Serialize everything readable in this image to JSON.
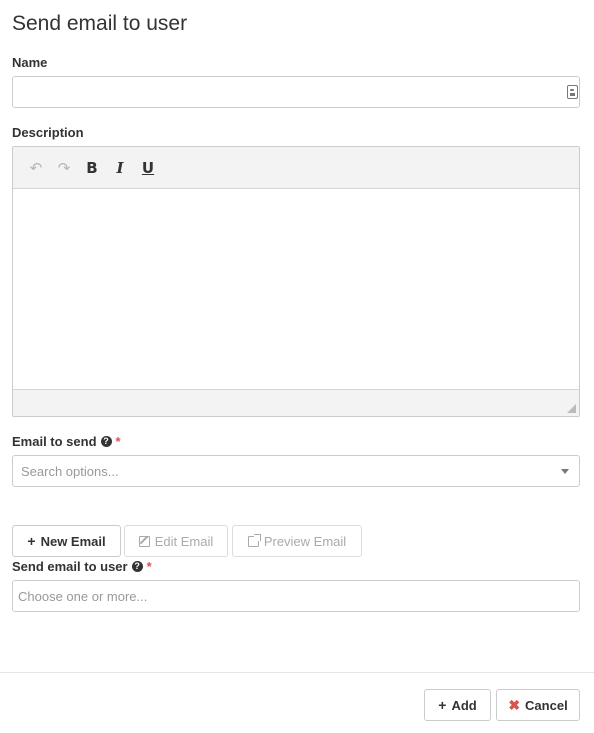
{
  "dialog": {
    "title": "Send email to user"
  },
  "name_field": {
    "label": "Name",
    "value": "",
    "placeholder": "",
    "icon": "contact-card-icon"
  },
  "description_field": {
    "label": "Description",
    "toolbar": {
      "undo": "↶",
      "redo": "↷",
      "bold": "B",
      "italic": "I",
      "underline": "U"
    }
  },
  "email_to_send": {
    "label": "Email to send",
    "help": "?",
    "required": "*",
    "placeholder": "Search options..."
  },
  "email_actions": {
    "new_email": "New Email",
    "edit_email": "Edit Email",
    "preview_email": "Preview Email"
  },
  "send_to_user": {
    "label": "Send email to user",
    "help": "?",
    "required": "*",
    "placeholder": "Choose one or more..."
  },
  "footer": {
    "add": "Add",
    "cancel": "Cancel"
  },
  "colors": {
    "required": "#d9534f",
    "border": "#cccccc",
    "toolbar_bg": "#f3f3f3"
  }
}
